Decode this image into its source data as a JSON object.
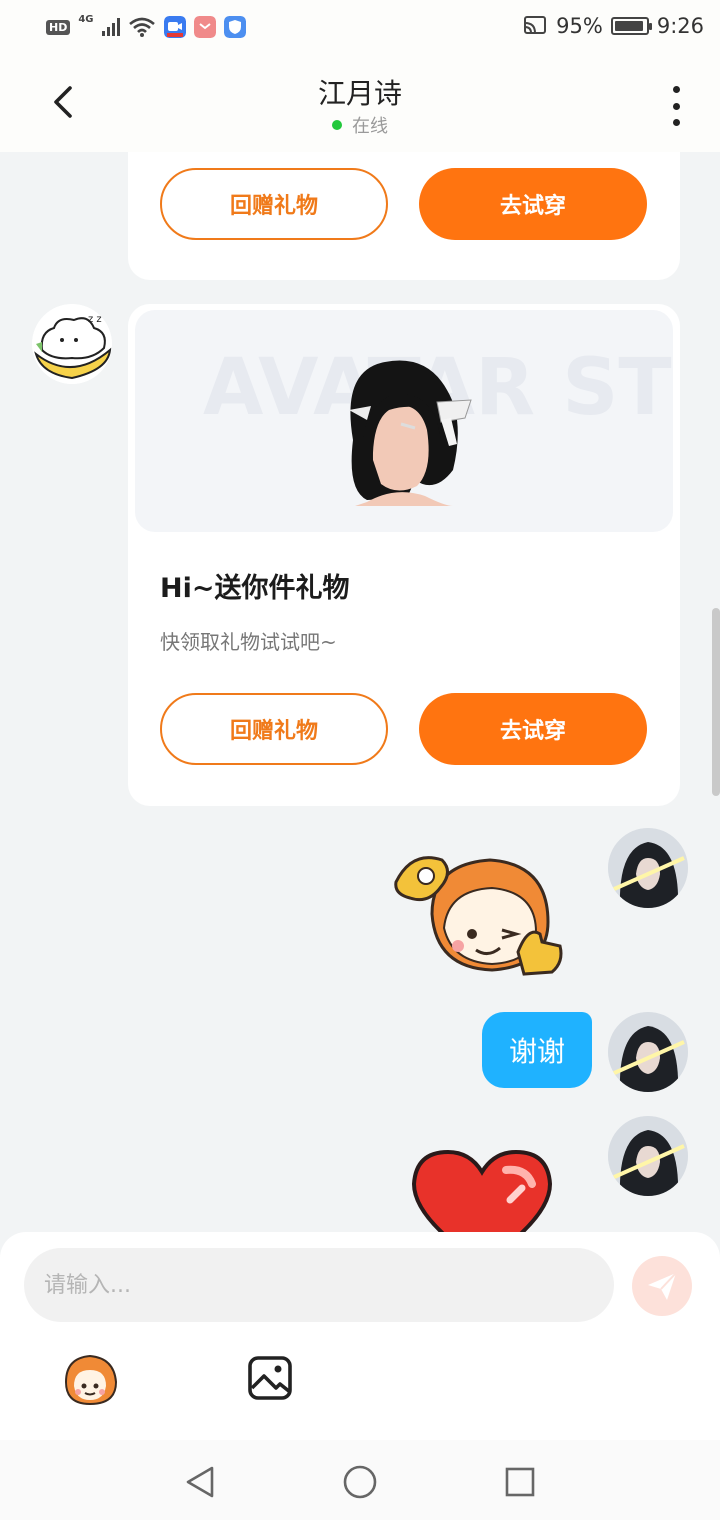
{
  "status_bar": {
    "network_type": "4G",
    "hd_label": "HD",
    "battery": "95%",
    "time": "9:26"
  },
  "header": {
    "title": "江月诗",
    "presence": "在线"
  },
  "messages": {
    "gift_card_1": {
      "return_gift_label": "回赠礼物",
      "try_on_label": "去试穿"
    },
    "gift_card_2": {
      "preview_watermark": "AVATAR STORE",
      "title": "Hi~送你件礼物",
      "subtitle": "快领取礼物试试吧~",
      "return_gift_label": "回赠礼物",
      "try_on_label": "去试穿"
    },
    "my_text": "谢谢"
  },
  "composer": {
    "placeholder": "请输入...",
    "send_icon": "send-icon",
    "sticker_icon": "sticker-icon",
    "image_icon": "image-icon"
  },
  "colors": {
    "accent": "#ff7410",
    "bubble_me": "#1fb2ff",
    "online": "#22c83c"
  }
}
